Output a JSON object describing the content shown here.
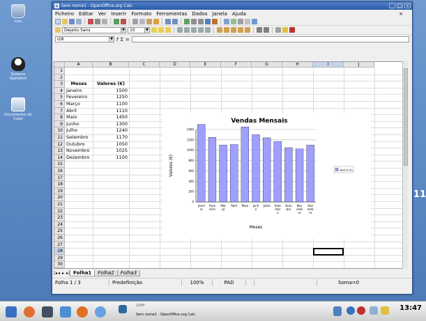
{
  "desktop": {
    "icons": [
      "Lixo",
      "Sistema Operativo",
      "Documentos do Cubo"
    ],
    "side_number": "11"
  },
  "window": {
    "title": "Sem nome1 - OpenOffice.org Calc"
  },
  "menu": [
    "Ficheiro",
    "Editar",
    "Ver",
    "Inserir",
    "Formato",
    "Ferramentas",
    "Dados",
    "Janela",
    "Ajuda"
  ],
  "format": {
    "font_name": "DejaVu Sans",
    "font_size": "10"
  },
  "formula": {
    "name_box": "I28",
    "fx": "f",
    "sigma": "Σ",
    "equals": "="
  },
  "columns": [
    "A",
    "B",
    "C",
    "D",
    "E",
    "F",
    "G",
    "H",
    "I",
    "J"
  ],
  "rows": [
    "1",
    "2",
    "3",
    "4",
    "5",
    "6",
    "7",
    "8",
    "9",
    "10",
    "11",
    "12",
    "13",
    "14",
    "15",
    "16",
    "17",
    "18",
    "19",
    "20",
    "21",
    "22",
    "23",
    "24",
    "25",
    "26",
    "27",
    "28",
    "29",
    "30"
  ],
  "sheet": {
    "header_month": "Meses",
    "header_value": "Valores (€)",
    "months": [
      "Janeiro",
      "Fevereiro",
      "Março",
      "Abril",
      "Maio",
      "Junho",
      "Julho",
      "Setembro",
      "Outubro",
      "Novembro",
      "Dezembro"
    ],
    "values": [
      "1500",
      "1250",
      "1100",
      "1110",
      "1450",
      "1300",
      "1240",
      "1170",
      "1050",
      "1025",
      "1100"
    ]
  },
  "tabs": [
    "Folha1",
    "Folha2",
    "Folha3"
  ],
  "status": {
    "sheet": "Folha 1 / 3",
    "style": "Predefinição",
    "zoom": "100%",
    "mode": "PAD",
    "sum": "Soma=0"
  },
  "chart_data": {
    "type": "bar",
    "title": "Vendas Mensais",
    "xlabel": "Meses",
    "ylabel": "Valores (€)",
    "categories": [
      "Janeiro",
      "Fevereiro",
      "Março",
      "Abril",
      "Maio",
      "Junho",
      "Julho",
      "Setembro",
      "Outubro",
      "Novembro",
      "Dezembro"
    ],
    "category_labels": [
      [
        "Janei",
        "ro"
      ],
      [
        "Feve",
        "reiro"
      ],
      [
        "Mar",
        "ço"
      ],
      [
        "Abril"
      ],
      [
        "Maio"
      ],
      [
        "Junh",
        "o"
      ],
      [
        "Julho"
      ],
      [
        "Sete",
        "mbr",
        "o"
      ],
      [
        "Outu",
        "bro"
      ],
      [
        "Nov",
        "emb",
        "ro"
      ],
      [
        "Dez",
        "emb",
        "ro"
      ]
    ],
    "series": [
      {
        "name": "Valores (€)",
        "values": [
          1500,
          1250,
          1100,
          1110,
          1450,
          1300,
          1240,
          1170,
          1050,
          1025,
          1100
        ]
      }
    ],
    "ylim": [
      0,
      1400
    ],
    "yticks": [
      "0",
      "200",
      "400",
      "600",
      "800",
      "1000",
      "1200",
      "1400"
    ],
    "grid": true,
    "legend": "right",
    "bar_color": "#9f9fff"
  },
  "taskbar": {
    "task_top": "GIMP",
    "task_bottom": "Sem nome1 - OpenOffice.org Calc",
    "clock": "13:47"
  }
}
